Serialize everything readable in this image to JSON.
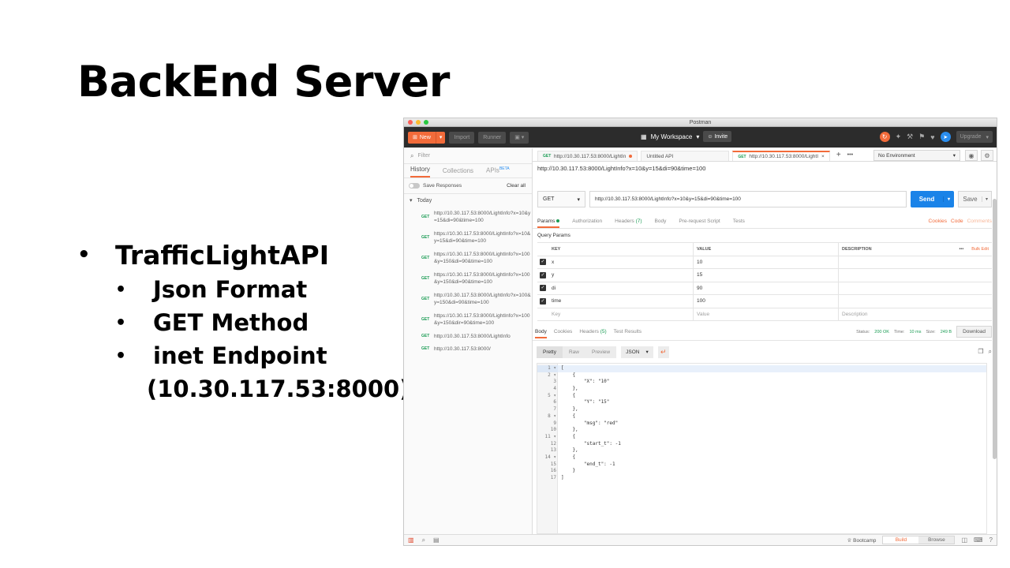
{
  "slide": {
    "title": "BackEnd Server",
    "bullet_main": "TrafficLightAPI",
    "sub_bullets": [
      "Json Format",
      "GET Method",
      "inet Endpoint"
    ],
    "endpoint_cont": "(10.30.117.53:8000)",
    "bullet_char": "•"
  },
  "window": {
    "title": "Postman"
  },
  "header": {
    "new_label": "New",
    "import_label": "Import",
    "runner_label": "Runner",
    "workspace_label": "My Workspace",
    "invite_label": "Invite",
    "upgrade_label": "Upgrade"
  },
  "sidebar": {
    "filter_placeholder": "Filter",
    "tabs": {
      "history": "History",
      "collections": "Collections",
      "apis": "APIs",
      "beta": "BETA"
    },
    "save_responses": "Save Responses",
    "clear_all": "Clear all",
    "today": "Today",
    "items": [
      {
        "method": "GET",
        "url": "http://10.30.117.53:8000/LightInfo?x=10&y=15&di=90&time=100"
      },
      {
        "method": "GET",
        "url": "https://10.30.117.53:8000/LightInfo?x=10&y=15&di=90&time=100"
      },
      {
        "method": "GET",
        "url": "https://10.30.117.53:8000/LightInfo?x=100&y=150&di=90&time=100"
      },
      {
        "method": "GET",
        "url": "https://10.30.117.53:8000/LightInfo?x=100&y=150&di=90&time=100"
      },
      {
        "method": "GET",
        "url": "http://10.30.117.53:8000/LightInfo?x=100&y=150&di=90&time=100"
      },
      {
        "method": "GET",
        "url": "https://10.30.117.53:8000/LightInfo?x=100&y=150&dir=90&time=100"
      },
      {
        "method": "GET",
        "url": "http://10.30.117.53:8000/LightInfo"
      },
      {
        "method": "GET",
        "url": "http://10.30.117.53:8000/"
      }
    ]
  },
  "tabs": [
    {
      "method": "GET",
      "label": "http://10.30.117.53:8000/LightIn"
    },
    {
      "label": "Untitled API"
    },
    {
      "method": "GET",
      "label": "http://10.30.117.53:8000/LightI"
    }
  ],
  "tab_add": "+",
  "tab_more": "•••",
  "environment": "No Environment",
  "request": {
    "name": "http://10.30.117.53:8000/LightInfo?x=10&y=15&di=90&time=100",
    "method": "GET",
    "url": "http://10.30.117.53:8000/LightInfo?x=10&y=15&di=90&time=100",
    "send_label": "Send",
    "save_label": "Save"
  },
  "req_tabs": {
    "params": "Params",
    "authorization": "Authorization",
    "headers": "Headers",
    "headers_count": "(7)",
    "body": "Body",
    "prerequest": "Pre-request Script",
    "tests": "Tests",
    "cookies": "Cookies",
    "code": "Code",
    "comments": "Comments"
  },
  "query_params": {
    "title": "Query Params",
    "columns": {
      "key": "KEY",
      "value": "VALUE",
      "description": "DESCRIPTION",
      "more": "•••",
      "bulk_edit": "Bulk Edit"
    },
    "rows": [
      {
        "key": "x",
        "value": "10"
      },
      {
        "key": "y",
        "value": "15"
      },
      {
        "key": "di",
        "value": "90"
      },
      {
        "key": "time",
        "value": "100"
      }
    ],
    "placeholders": {
      "key": "Key",
      "value": "Value",
      "description": "Description"
    }
  },
  "response": {
    "tabs": {
      "body": "Body",
      "cookies": "Cookies",
      "headers": "Headers",
      "headers_count": "(5)",
      "test_results": "Test Results"
    },
    "status_label": "Status:",
    "status": "200 OK",
    "time_label": "Time:",
    "time": "10 ms",
    "size_label": "Size:",
    "size": "249 B",
    "download_label": "Download",
    "format": {
      "pretty": "Pretty",
      "raw": "Raw",
      "preview": "Preview",
      "json": "JSON"
    }
  },
  "code_lines": [
    {
      "n": "1 ▾",
      "t": "["
    },
    {
      "n": "2 ▾",
      "t": "    {"
    },
    {
      "n": "3",
      "t": "        \"X\": \"10\""
    },
    {
      "n": "4",
      "t": "    },"
    },
    {
      "n": "5 ▾",
      "t": "    {"
    },
    {
      "n": "6",
      "t": "        \"Y\": \"15\""
    },
    {
      "n": "7",
      "t": "    },"
    },
    {
      "n": "8 ▾",
      "t": "    {"
    },
    {
      "n": "9",
      "t": "        \"msg\": \"red\""
    },
    {
      "n": "10",
      "t": "    },"
    },
    {
      "n": "11 ▾",
      "t": "    {"
    },
    {
      "n": "12",
      "t": "        \"start_t\": -1"
    },
    {
      "n": "13",
      "t": "    },"
    },
    {
      "n": "14 ▾",
      "t": "    {"
    },
    {
      "n": "15",
      "t": "        \"end_t\": -1"
    },
    {
      "n": "16",
      "t": "    }"
    },
    {
      "n": "17",
      "t": "]"
    }
  ],
  "footer": {
    "bootcamp": "Bootcamp",
    "build": "Build",
    "browse": "Browse"
  },
  "colors": {
    "accent": "#f26b3a",
    "send_blue": "#1a83e8",
    "get_green": "#1a9c54",
    "header_dark": "#2c2c2c"
  },
  "icons": [
    "search-icon",
    "plus-icon",
    "grid-icon",
    "person-icon",
    "sync-icon",
    "satellite-icon",
    "wrench-icon",
    "bell-icon",
    "heart-icon",
    "rocket-icon",
    "eye-icon",
    "gear-icon",
    "copy-icon",
    "sidebar-icon",
    "console-icon",
    "bootcamp-icon",
    "layout-icon",
    "help-icon"
  ]
}
